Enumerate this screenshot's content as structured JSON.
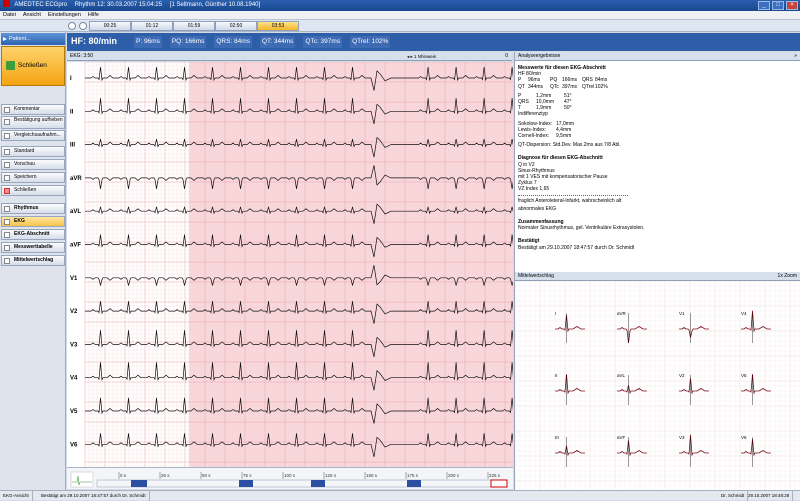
{
  "titlebar": {
    "app": "AMEDTEC ECGpro",
    "record": "Rhythm 12: 30.03.2007 15:04:25",
    "patient": "[1 Seltmann, Günther 10.08.1940]"
  },
  "menu": [
    "Datei",
    "Ansicht",
    "Einstellungen",
    "Hilfe"
  ],
  "time_tabs": [
    "00:25",
    "01:12",
    "01:59",
    "02:50",
    "03:53"
  ],
  "active_tab": 4,
  "sidebar": {
    "patient": "Patient...",
    "close_big": "Schließen",
    "items": [
      "Kommentar",
      "Bestätigung aufheben",
      "Vergleichsaufnahm...",
      "Standard",
      "Vorschau",
      "Speichern",
      "Schließen"
    ],
    "views": [
      "Rhythmus",
      "EKG",
      "EKG-Abschnitt",
      "Messwerttabelle",
      "Mittelwertschlag"
    ]
  },
  "header": {
    "hr": "HF: 80/min",
    "intervals": [
      "P: 96ms",
      "PQ: 166ms",
      "QRS: 84ms",
      "QT: 344ms",
      "QTc: 397ms",
      "QTrel: 102%"
    ]
  },
  "ecg": {
    "bar_label": "EKG:  3:50",
    "controls": "◂ ▸  1 Nhinweis",
    "page": "0",
    "leads": [
      "I",
      "II",
      "III",
      "aVR",
      "aVL",
      "aVF",
      "V1",
      "V2",
      "V3",
      "V4",
      "V5",
      "V6"
    ],
    "time_labels": [
      "0 s",
      "25 s",
      "50 s",
      "75 s",
      "100 s",
      "125 s",
      "150 s",
      "175 s",
      "200 s",
      "225 s"
    ]
  },
  "analysis": {
    "header": "Analyseergebnisse",
    "title": "Messwerte für diesen EKG-Abschnitt",
    "hf": "HF 80/min",
    "rows": [
      [
        "P",
        "96ms",
        "PQ",
        "166ms",
        "QRS",
        "84ms"
      ],
      [
        "QT",
        "344ms",
        "QTc",
        "397ms",
        "QTrel",
        "102%"
      ]
    ],
    "axes": [
      [
        "P",
        "1,2mm",
        "51°"
      ],
      [
        "QRS",
        "10,0mm",
        "47°"
      ],
      [
        "T",
        "1,9mm",
        "50°"
      ]
    ],
    "type": "Indifferenztyp",
    "indices": [
      [
        "Sokolow-Index:",
        "17,0mm"
      ],
      [
        "Lewis-Index:",
        "4,4mm"
      ],
      [
        "Cornell-Index:",
        "9,5mm"
      ]
    ],
    "qt": "QT-Dispersion: Std.Dev. Max.2ms aus 7/8 Abl.",
    "diag_title": "Diagnose für diesen EKG-Abschnitt",
    "diag": [
      "Q in              V2",
      "Sinus-Rhythmus",
      "mit 1 VES mit kompensatorischer Pause",
      "Zyklus       7",
      "VZ Index   1,65",
      "fraglich Anteroleteral-Infarkt, wahrscheinlich alt",
      "abnormales EKG"
    ],
    "sum_title": "Zusammenfassung",
    "sum": "Normaler Sinusrhythmus, gel. Ventrikuläre Extrasystolen.",
    "conf_title": "Bestätigt",
    "conf": "Bestätigt am 29.10.2007 18:47:57 durch Dr. Schmidt"
  },
  "avg": {
    "header": "Mittelwertschlag",
    "zoom": "1x Zoom",
    "leads": [
      "I",
      "aVR",
      "V1",
      "V4",
      "II",
      "aVL",
      "V2",
      "V5",
      "III",
      "aVF",
      "V3",
      "V6"
    ]
  },
  "status": {
    "left": "EKG-Ansicht",
    "confirm": "Bestätigt am 29.10.2007 18:47:57 durch Dr. Schmidt",
    "user": "Dr. Schmidt",
    "time": "29.10.2007 18:48:28"
  },
  "colors": {
    "accent": "#2f5ea9",
    "highlight": "#f7c24a",
    "grid": "#f3c4c8",
    "trace": "#000000"
  }
}
